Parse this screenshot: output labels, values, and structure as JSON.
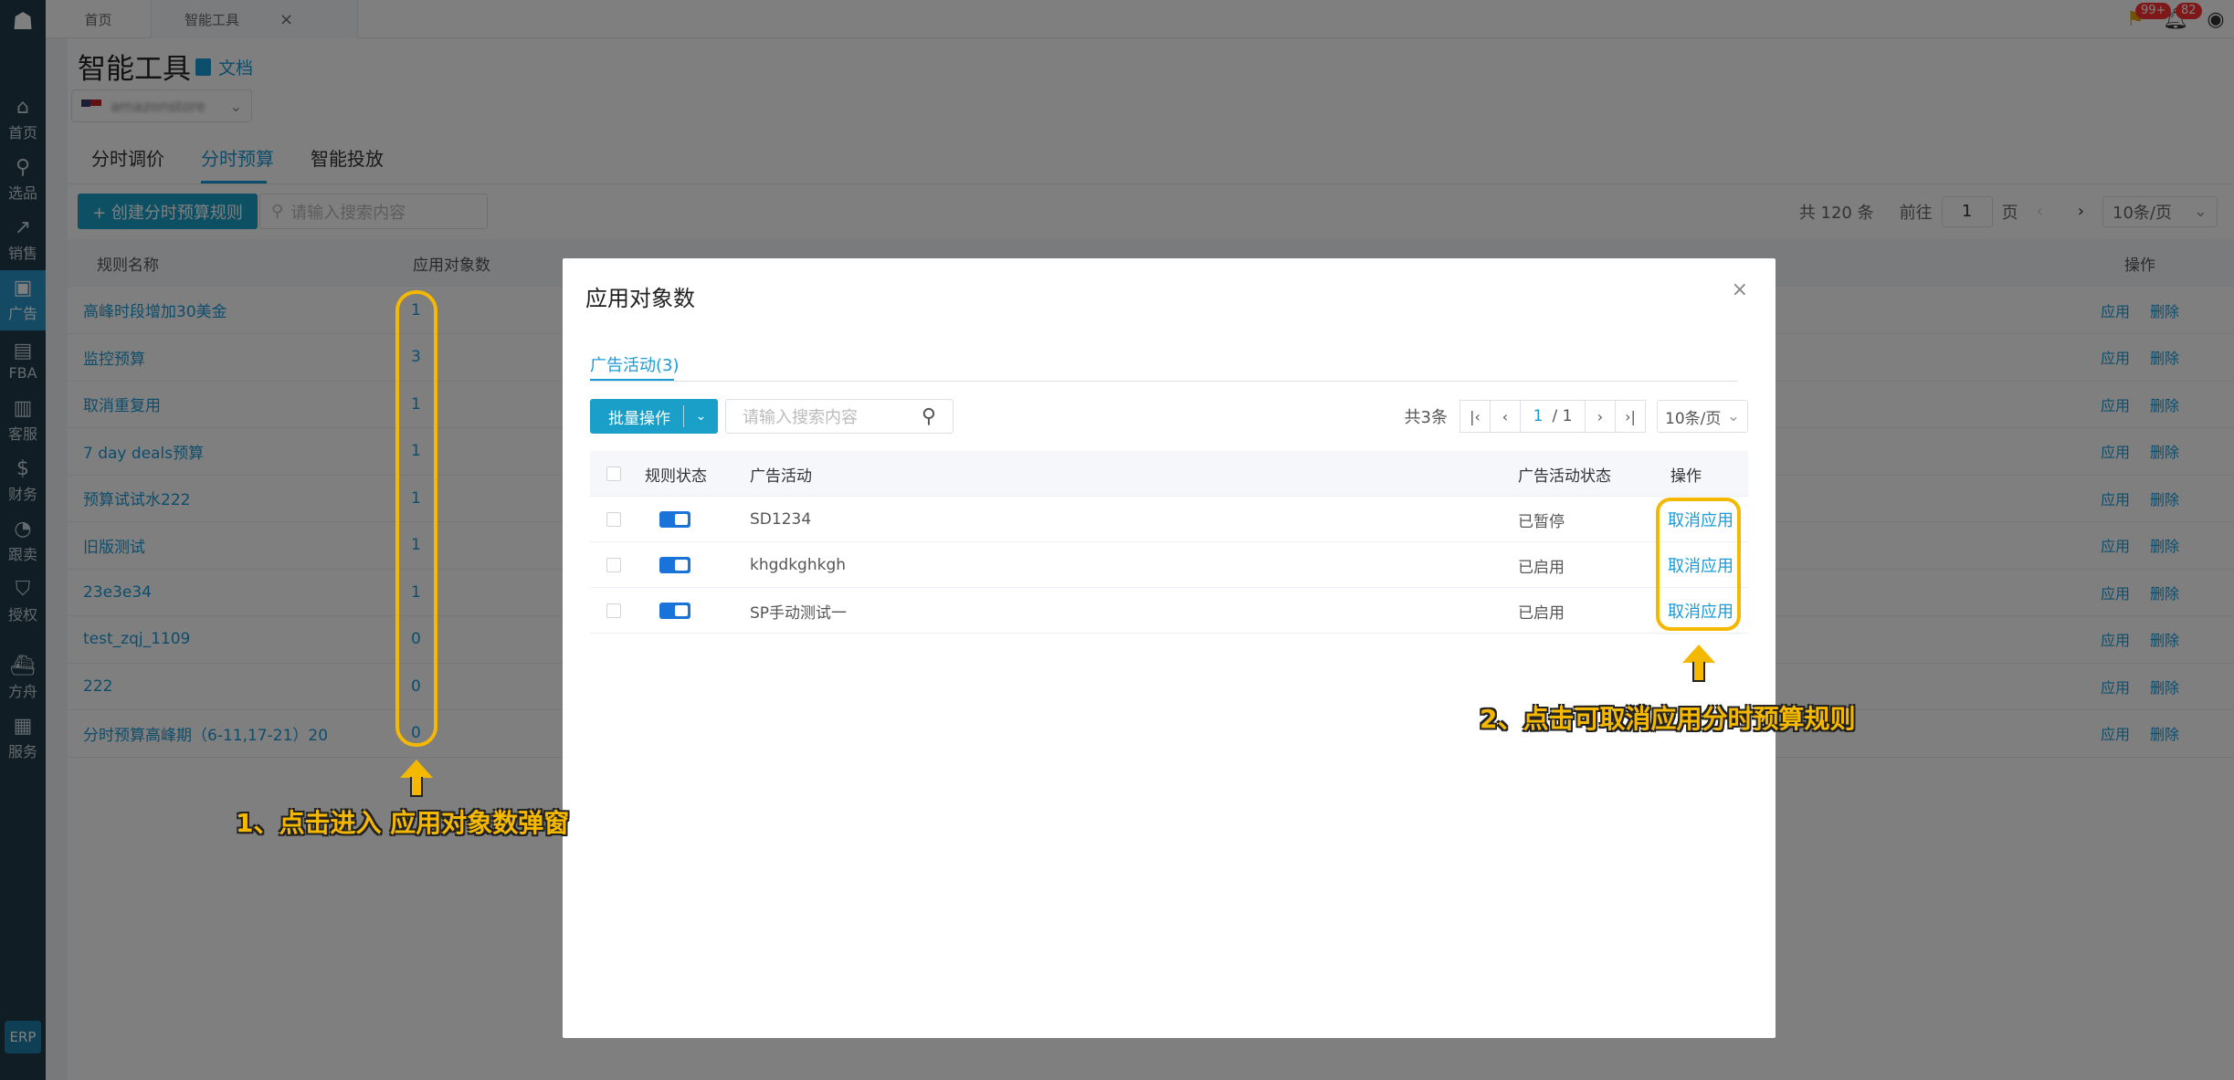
{
  "sidebar": {
    "items": [
      {
        "label": "首页",
        "icon": "home-icon",
        "glyph": "⌂"
      },
      {
        "label": "选品",
        "icon": "search-icon",
        "glyph": "⚲"
      },
      {
        "label": "销售",
        "icon": "chart-icon",
        "glyph": "↗"
      },
      {
        "label": "广告",
        "icon": "ad-icon",
        "glyph": "▣"
      },
      {
        "label": "FBA",
        "icon": "warehouse-icon",
        "glyph": "▤"
      },
      {
        "label": "客服",
        "icon": "service-icon",
        "glyph": "▥"
      },
      {
        "label": "财务",
        "icon": "dollar-icon",
        "glyph": "$"
      },
      {
        "label": "跟卖",
        "icon": "pie-icon",
        "glyph": "◔"
      },
      {
        "label": "授权",
        "icon": "shield-icon",
        "glyph": "⛉"
      },
      {
        "label": "方舟",
        "icon": "ark-icon",
        "glyph": "⛴"
      },
      {
        "label": "服务",
        "icon": "building-icon",
        "glyph": "▦"
      }
    ],
    "active_index": 3,
    "erp_label": "ERP"
  },
  "topbar": {
    "tabs": [
      {
        "label": "首页"
      },
      {
        "label": "智能工具",
        "close": "×"
      }
    ],
    "badges": {
      "flag": "99+",
      "bell": "82"
    }
  },
  "page": {
    "title": "智能工具",
    "doc_link": "文档",
    "store_name": "amazonstore"
  },
  "subtabs": [
    "分时调价",
    "分时预算",
    "智能投放"
  ],
  "toolbar": {
    "create_label": "+ 创建分时预算规则",
    "search_placeholder": "请输入搜索内容"
  },
  "pager": {
    "total": "共 120 条",
    "goto": "前往",
    "page": "1",
    "page_unit": "页",
    "size": "10条/页"
  },
  "table": {
    "headers": {
      "name": "规则名称",
      "count": "应用对象数",
      "ops": "操作"
    },
    "op_apply": "应用",
    "op_delete": "删除",
    "rows": [
      {
        "name": "高峰时段增加30美金",
        "count": "1"
      },
      {
        "name": "监控预算",
        "count": "3"
      },
      {
        "name": "取消重复用",
        "count": "1"
      },
      {
        "name": "7 day deals预算",
        "count": "1"
      },
      {
        "name": "预算试试水222",
        "count": "1"
      },
      {
        "name": "旧版测试",
        "count": "1"
      },
      {
        "name": "23e3e34",
        "count": "1"
      },
      {
        "name": "test_zqj_1109",
        "count": "0"
      },
      {
        "name": "222",
        "count": "0"
      },
      {
        "name": "分时预算高峰期（6-11,17-21）20",
        "count": "0"
      }
    ]
  },
  "modal": {
    "title": "应用对象数",
    "close": "×",
    "tab": "广告活动(3)",
    "batch_label": "批量操作",
    "search_placeholder": "请输入搜索内容",
    "count": "共3条",
    "page_current": "1",
    "page_total": "/ 1",
    "page_size": "10条/页",
    "headers": {
      "status": "规则状态",
      "campaign": "广告活动",
      "campaign_status": "广告活动状态",
      "ops": "操作"
    },
    "rows": [
      {
        "campaign": "SD1234",
        "status": "已暂停",
        "action": "取消应用"
      },
      {
        "campaign": "khgdkghkgh",
        "status": "已启用",
        "action": "取消应用"
      },
      {
        "campaign": "SP手动测试一",
        "status": "已启用",
        "action": "取消应用"
      }
    ]
  },
  "annotations": {
    "note1": "1、点击进入 应用对象数弹窗",
    "note2": "2、点击可取消应用分时预算规则"
  },
  "colors": {
    "accent": "#1a9bd8",
    "sidebar": "#223b48",
    "highlight": "#f5b800"
  }
}
